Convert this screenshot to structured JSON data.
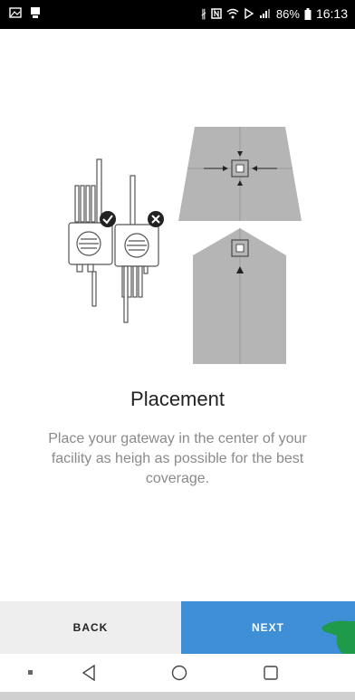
{
  "status_bar": {
    "battery": "86%",
    "time": "16:13"
  },
  "onboarding": {
    "title": "Placement",
    "description": "Place your gateway in the center of your facility as heigh as possible for the best coverage."
  },
  "buttons": {
    "back_label": "BACK",
    "next_label": "NEXT"
  },
  "colors": {
    "accent": "#3F8FD6",
    "illustration_gray": "#B5B5B5"
  },
  "icons": [
    "gallery-icon",
    "screen-cast-icon",
    "bluetooth-icon",
    "nfc-icon",
    "wifi-icon",
    "data-saver-icon",
    "signal-icon",
    "battery-icon",
    "back-nav-icon",
    "home-nav-icon",
    "recents-nav-icon",
    "menu-dot-icon"
  ]
}
